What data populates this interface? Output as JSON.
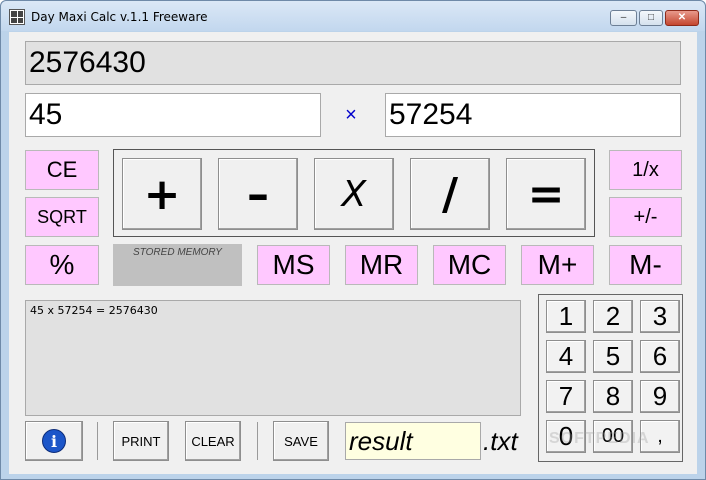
{
  "window": {
    "title": "Day Maxi Calc  v.1.1 Freeware",
    "minimize_glyph": "–",
    "maximize_glyph": "□",
    "close_glyph": "✕"
  },
  "display": {
    "result": "2576430",
    "operand1": "45",
    "operator": "×",
    "operand2": "57254"
  },
  "left_buttons": {
    "ce": "CE",
    "sqrt": "SQRT",
    "percent": "%"
  },
  "right_buttons": {
    "reciprocal": "1/x",
    "sign": "+/-",
    "mminus": "M-"
  },
  "operators": {
    "plus": "+",
    "minus": "–",
    "multiply": "X",
    "divide": "/",
    "equals": "="
  },
  "memory": {
    "label": "STORED MEMORY",
    "value": "",
    "ms": "MS",
    "mr": "MR",
    "mc": "MC",
    "mplus": "M+"
  },
  "tape": {
    "lines": [
      "45 x 57254 = 2576430"
    ]
  },
  "keypad": [
    "1",
    "2",
    "3",
    "4",
    "5",
    "6",
    "7",
    "8",
    "9",
    "0",
    "00",
    ","
  ],
  "bottom": {
    "info_icon": "i",
    "print": "PRINT",
    "clear": "CLEAR",
    "save": "SAVE",
    "filename": "result",
    "extension": ".txt"
  },
  "watermark": "SOFTPEDIA",
  "colors": {
    "pink": "#ffc8ff",
    "accent_blue": "#0000cc",
    "lcd": "#e1e1e1",
    "filename_bg": "#ffffe1"
  }
}
